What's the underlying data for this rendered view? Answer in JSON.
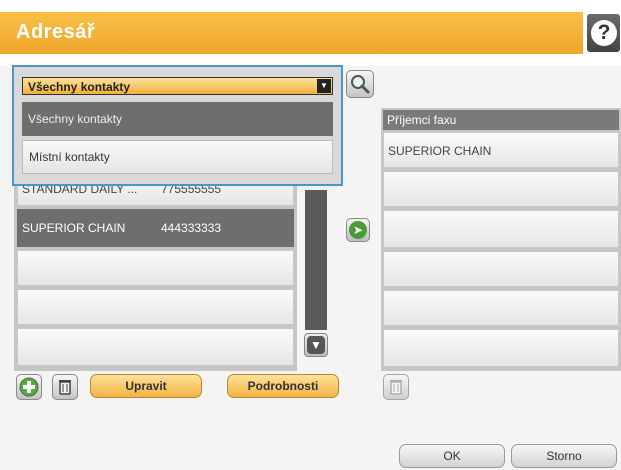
{
  "header": {
    "title": "Adresář",
    "help_symbol": "?"
  },
  "dropdown": {
    "selected": "Všechny kontakty",
    "options": [
      "Všechny kontakty",
      "Místní kontakty"
    ]
  },
  "contacts": {
    "partial_row": {
      "name": "STANDARD DAILY ...",
      "number": "775555555"
    },
    "rows": [
      {
        "name": "SUPERIOR CHAIN",
        "number": "444333333"
      }
    ]
  },
  "fax_recipients": {
    "header": "Příjemci faxu",
    "items": [
      "SUPERIOR CHAIN"
    ]
  },
  "buttons": {
    "edit": "Upravit",
    "details": "Podrobnosti",
    "ok": "OK",
    "cancel": "Storno"
  },
  "colors": {
    "accent": "#f2ab30",
    "selection": "#6e6e6e",
    "focus": "#4a96c8"
  }
}
